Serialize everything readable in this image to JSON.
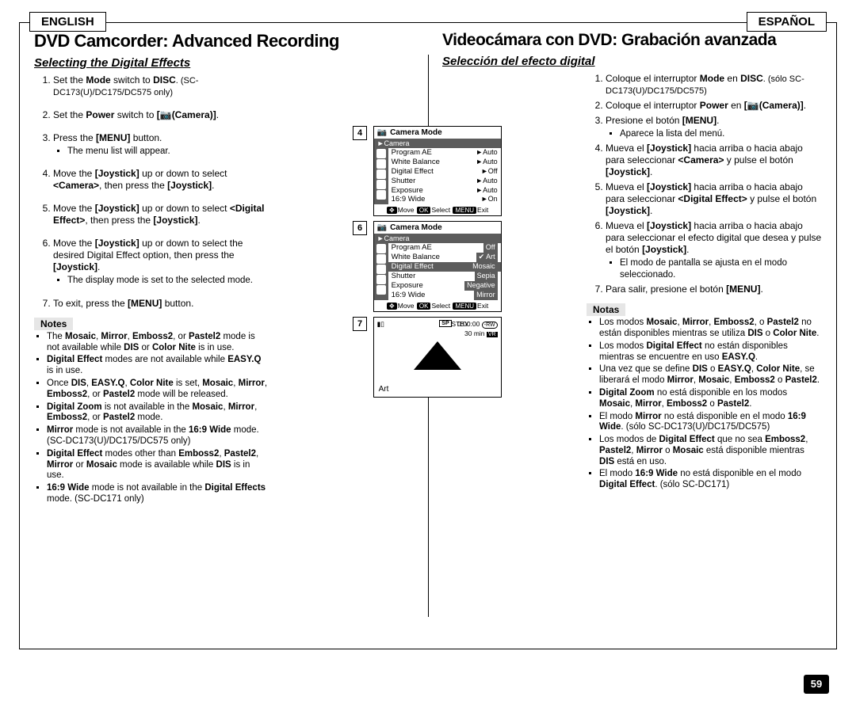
{
  "lang_en": "ENGLISH",
  "lang_es": "ESPAÑOL",
  "page_number": "59",
  "en": {
    "title": "DVD Camcorder: Advanced Recording",
    "subtitle": "Selecting the Digital Effects",
    "step1_a": "Set the ",
    "step1_b": "Mode",
    "step1_c": " switch to ",
    "step1_d": "DISC",
    "step1_e": ". (SC-DC173(U)/DC175/DC575 only)",
    "step2_a": "Set the ",
    "step2_b": "Power",
    "step2_c": " switch to ",
    "step2_d": "[📷(Camera)]",
    "step2_e": ".",
    "step3_a": "Press the ",
    "step3_b": "[MENU]",
    "step3_c": " button.",
    "step3_sub": "The menu list will appear.",
    "step4_a": "Move the ",
    "step4_b": "[Joystick]",
    "step4_c": " up or down to select ",
    "step4_d": "<Camera>",
    "step4_e": ", then press the ",
    "step4_f": "[Joystick]",
    "step4_g": ".",
    "step5_a": "Move the ",
    "step5_b": "[Joystick]",
    "step5_c": " up or down to select ",
    "step5_d": "<Digital Effect>",
    "step5_e": ", then press the ",
    "step5_f": "[Joystick]",
    "step5_g": ".",
    "step6_a": "Move the ",
    "step6_b": "[Joystick]",
    "step6_c": " up or down to select the desired Digital Effect option, then press the ",
    "step6_d": "[Joystick]",
    "step6_e": ".",
    "step6_sub": "The display mode is set to the selected mode.",
    "step7_a": "To exit, press the ",
    "step7_b": "[MENU]",
    "step7_c": " button.",
    "notes_h": "Notes",
    "n1_a": "The ",
    "n1_b": "Mosaic",
    "n1_c": ", ",
    "n1_d": "Mirror",
    "n1_e": ", ",
    "n1_f": "Emboss2",
    "n1_g": ", or ",
    "n1_h": "Pastel2",
    "n1_i": " mode is not available while ",
    "n1_j": "DIS",
    "n1_k": " or ",
    "n1_l": "Color Nite",
    "n1_m": " is in use.",
    "n2_a": "Digital Effect",
    "n2_b": " modes are not available while ",
    "n2_c": "EASY.Q",
    "n2_d": " is in use.",
    "n3_a": "Once ",
    "n3_b": "DIS",
    "n3_c": ", ",
    "n3_d": "EASY.Q",
    "n3_e": ", ",
    "n3_f": "Color Nite",
    "n3_g": " is set, ",
    "n3_h": "Mosaic",
    "n3_i": ", ",
    "n3_j": "Mirror",
    "n3_k": ", ",
    "n3_l": "Emboss2",
    "n3_m": ", or ",
    "n3_n": "Pastel2",
    "n3_o": " mode will be released.",
    "n4_a": "Digital Zoom",
    "n4_b": " is not available in the ",
    "n4_c": "Mosaic",
    "n4_d": ", ",
    "n4_e": "Mirror",
    "n4_f": ", ",
    "n4_g": "Emboss2",
    "n4_h": ", or ",
    "n4_i": "Pastel2",
    "n4_j": " mode.",
    "n5_a": "Mirror",
    "n5_b": " mode is not available in the ",
    "n5_c": "16:9 Wide",
    "n5_d": " mode. (SC-DC173(U)/DC175/DC575 only)",
    "n6_a": "Digital Effect",
    "n6_b": " modes other than ",
    "n6_c": "Emboss2",
    "n6_d": ", ",
    "n6_e": "Pastel2",
    "n6_f": ", ",
    "n6_g": "Mirror",
    "n6_h": " or ",
    "n6_i": "Mosaic",
    "n6_j": " mode is available while ",
    "n6_k": "DIS",
    "n6_l": " is in use.",
    "n7_a": "16:9 Wide",
    "n7_b": " mode is not available in the ",
    "n7_c": "Digital Effects",
    "n7_d": " mode. (SC-DC171 only)"
  },
  "es": {
    "title": "Videocámara con DVD: Grabación avanzada",
    "subtitle": "Selección del efecto digital",
    "step1_a": "Coloque el interruptor ",
    "step1_b": "Mode",
    "step1_c": " en ",
    "step1_d": "DISC",
    "step1_e": ". (sólo SC-DC173(U)/DC175/DC575)",
    "step2_a": "Coloque el interruptor ",
    "step2_b": "Power",
    "step2_c": " en ",
    "step2_d": "[📷(Camera)]",
    "step2_e": ".",
    "step3_a": "Presione el botón ",
    "step3_b": "[MENU]",
    "step3_c": ".",
    "step3_sub": "Aparece la lista del menú.",
    "step4_a": "Mueva el ",
    "step4_b": "[Joystick]",
    "step4_c": " hacia arriba o hacia abajo para seleccionar ",
    "step4_d": "<Camera>",
    "step4_e": " y pulse el botón ",
    "step4_f": "[Joystick]",
    "step4_g": ".",
    "step5_a": "Mueva el ",
    "step5_b": "[Joystick]",
    "step5_c": " hacia arriba o hacia abajo para seleccionar ",
    "step5_d": "<Digital Effect>",
    "step5_e": " y pulse el botón ",
    "step5_f": "[Joystick]",
    "step5_g": ".",
    "step6_a": "Mueva el ",
    "step6_b": "[Joystick]",
    "step6_c": " hacia arriba o hacia abajo para seleccionar el efecto digital que desea y pulse el botón ",
    "step6_d": "[Joystick]",
    "step6_e": ".",
    "step6_sub": "El modo de pantalla se ajusta en el modo seleccionado.",
    "step7_a": "Para salir, presione el botón ",
    "step7_b": "[MENU]",
    "step7_c": ".",
    "notes_h": "Notas",
    "n1_a": "Los modos ",
    "n1_b": "Mosaic",
    "n1_c": ", ",
    "n1_d": "Mirror",
    "n1_e": ", ",
    "n1_f": "Emboss2",
    "n1_g": ", o ",
    "n1_h": "Pastel2",
    "n1_i": " no están disponibles mientras se utiliza ",
    "n1_j": "DIS",
    "n1_k": " o ",
    "n1_l": "Color Nite",
    "n1_m": ".",
    "n2_a": "Los modos ",
    "n2_b": "Digital Effect",
    "n2_c": " no están disponibles mientras se encuentre en uso ",
    "n2_d": "EASY.Q",
    "n2_e": ".",
    "n3_a": "Una vez que se define ",
    "n3_b": "DIS",
    "n3_c": " o ",
    "n3_d": "EASY.Q",
    "n3_e": ", ",
    "n3_f": "Color Nite",
    "n3_g": ", se liberará el modo ",
    "n3_h": "Mirror",
    "n3_i": ", ",
    "n3_j": "Mosaic",
    "n3_k": ", ",
    "n3_l": "Emboss2",
    "n3_m": " o ",
    "n3_n": "Pastel2",
    "n3_o": ".",
    "n4_a": "Digital Zoom",
    "n4_b": " no está disponible en los modos ",
    "n4_c": "Mosaic",
    "n4_d": ", ",
    "n4_e": "Mirror",
    "n4_f": ", ",
    "n4_g": "Emboss2",
    "n4_h": " o ",
    "n4_i": "Pastel2",
    "n4_j": ".",
    "n5_a": "El modo ",
    "n5_b": "Mirror",
    "n5_c": " no está disponible en el modo ",
    "n5_d": "16:9 Wide",
    "n5_e": ". (sólo SC-DC173(U)/DC175/DC575)",
    "n6_a": "Los modos de ",
    "n6_b": "Digital Effect",
    "n6_c": " que no sea ",
    "n6_d": "Emboss2",
    "n6_e": ", ",
    "n6_f": "Pastel2",
    "n6_g": ", ",
    "n6_h": "Mirror",
    "n6_i": " o ",
    "n6_j": "Mosaic",
    "n6_k": " está disponible mientras ",
    "n6_l": "DIS",
    "n6_m": " está en uso.",
    "n7_a": "El modo ",
    "n7_b": "16:9 Wide",
    "n7_c": " no está disponible en el modo ",
    "n7_d": "Digital Effect",
    "n7_e": ". (sólo SC-DC171)"
  },
  "fig": {
    "num4": "4",
    "num6": "6",
    "num7": "7",
    "camera_mode": "Camera Mode",
    "camera_banner": "►Camera",
    "rows4": [
      {
        "l": "Program AE",
        "v": "►Auto"
      },
      {
        "l": "White Balance",
        "v": "►Auto"
      },
      {
        "l": "Digital Effect",
        "v": "►Off"
      },
      {
        "l": "Shutter",
        "v": "►Auto"
      },
      {
        "l": "Exposure",
        "v": "►Auto"
      },
      {
        "l": "16:9 Wide",
        "v": "►On"
      }
    ],
    "rows6": [
      {
        "l": "Program AE",
        "v": "Off"
      },
      {
        "l": "White Balance",
        "v": "Art",
        "chk": true
      },
      {
        "l": "Digital Effect",
        "v": "Mosaic",
        "sel": true
      },
      {
        "l": "Shutter",
        "v": "Sepia"
      },
      {
        "l": "Exposure",
        "v": "Negative"
      },
      {
        "l": "16:9 Wide",
        "v": "Mirror"
      }
    ],
    "footer_move": "Move",
    "footer_select": "Select",
    "footer_exit": "Exit",
    "stby": "STBY",
    "sp": "SP",
    "time": "0:00:00",
    "rw": "-RW",
    "remain": "30 min",
    "vr": "VR",
    "art": "Art"
  }
}
